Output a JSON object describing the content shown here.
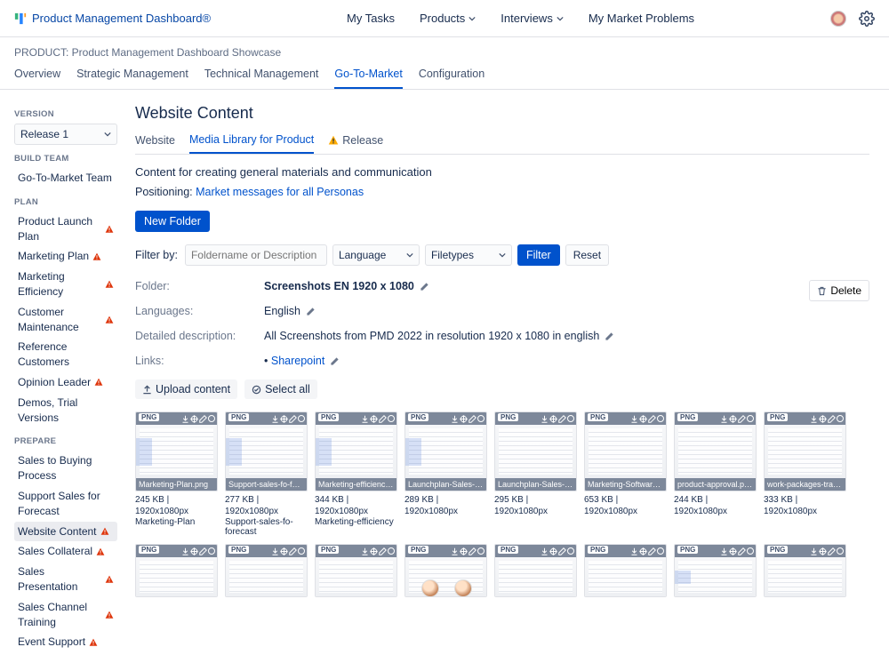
{
  "brand": "Product Management Dashboard®",
  "top_nav": {
    "my_tasks": "My Tasks",
    "products": "Products",
    "interviews": "Interviews",
    "my_market_problems": "My Market Problems"
  },
  "breadcrumb": "PRODUCT: Product Management Dashboard Showcase",
  "main_tabs": {
    "overview": "Overview",
    "strategic": "Strategic Management",
    "technical": "Technical Management",
    "gtm": "Go-To-Market",
    "config": "Configuration"
  },
  "sidebar": {
    "version_title": "VERSION",
    "version_value": "Release 1",
    "build_team_title": "BUILD TEAM",
    "build_team": "Go-To-Market Team",
    "plan_title": "PLAN",
    "plan_items": [
      {
        "label": "Product Launch Plan",
        "warn": true
      },
      {
        "label": "Marketing Plan",
        "warn": true
      },
      {
        "label": "Marketing Efficiency",
        "warn": true
      },
      {
        "label": "Customer Maintenance",
        "warn": true
      },
      {
        "label": "Reference Customers",
        "warn": false
      },
      {
        "label": "Opinion Leader",
        "warn": true
      },
      {
        "label": "Demos, Trial Versions",
        "warn": false
      }
    ],
    "prepare_title": "PREPARE",
    "prepare_items": [
      {
        "label": "Sales to Buying Process",
        "warn": false,
        "active": false
      },
      {
        "label": "Support Sales for Forecast",
        "warn": false,
        "active": false
      },
      {
        "label": "Website Content",
        "warn": true,
        "active": true
      },
      {
        "label": "Sales Collateral",
        "warn": true,
        "active": false
      },
      {
        "label": "Sales Presentation",
        "warn": true,
        "active": false
      },
      {
        "label": "Sales Channel Training",
        "warn": true,
        "active": false
      },
      {
        "label": "Event Support",
        "warn": true,
        "active": false
      }
    ]
  },
  "page": {
    "title": "Website Content",
    "sub_tabs": {
      "website": "Website",
      "media": "Media Library for Product",
      "release": "Release"
    },
    "desc": "Content for creating general materials and communication",
    "positioning_label": "Positioning:",
    "positioning_link": "Market messages for all Personas",
    "new_folder": "New Folder",
    "filter_label": "Filter by:",
    "filter_placeholder": "Foldername or Description",
    "lang_label": "Language",
    "filetypes_label": "Filetypes",
    "filter_btn": "Filter",
    "reset_btn": "Reset",
    "delete_btn": "Delete"
  },
  "meta": {
    "folder_label": "Folder:",
    "folder_value": "Screenshots EN 1920 x 1080",
    "languages_label": "Languages:",
    "languages_value": "English",
    "detailed_label": "Detailed description:",
    "detailed_value": "All Screenshots from PMD 2022 in resolution 1920 x 1080 in english",
    "links_label": "Links:",
    "links_value": "Sharepoint",
    "upload": "Upload content",
    "select_all": "Select all"
  },
  "cards_row1": [
    {
      "type": "PNG",
      "caption": "Marketing-Plan.png",
      "meta": "245 KB | 1920x1080px",
      "sub": "Marketing-Plan"
    },
    {
      "type": "PNG",
      "caption": "Support-sales-fo-forecast...",
      "meta": "277 KB | 1920x1080px",
      "sub": "Support-sales-fo-forecast"
    },
    {
      "type": "PNG",
      "caption": "Marketing-efficiency.png",
      "meta": "344 KB | 1920x1080px",
      "sub": "Marketing-efficiency"
    },
    {
      "type": "PNG",
      "caption": "Launchplan-Sales-Mat...",
      "meta": "289 KB | 1920x1080px",
      "sub": ""
    },
    {
      "type": "PNG",
      "caption": "Launchplan-Sales-Mate...",
      "meta": "295 KB | 1920x1080px",
      "sub": ""
    },
    {
      "type": "PNG",
      "caption": "Marketing-Software.png",
      "meta": "653 KB | 1920x1080px",
      "sub": ""
    },
    {
      "type": "PNG",
      "caption": "product-approval.png",
      "meta": "244 KB | 1920x1080px",
      "sub": ""
    },
    {
      "type": "PNG",
      "caption": "work-packages-transfer...",
      "meta": "333 KB | 1920x1080px",
      "sub": ""
    }
  ],
  "cards_row2_count": 8,
  "card_row2_type": "PNG"
}
